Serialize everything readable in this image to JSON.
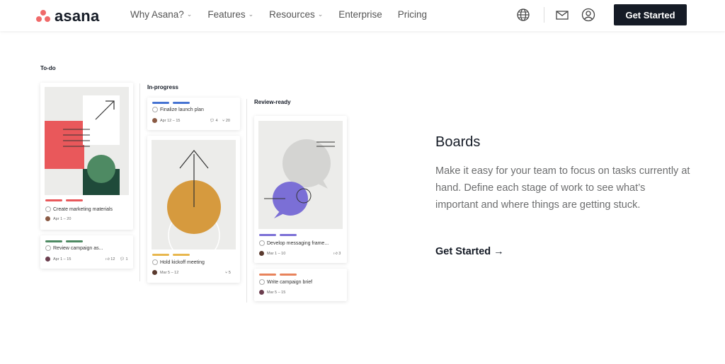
{
  "nav": {
    "logo_text": "asana",
    "menu": [
      {
        "label": "Why Asana?",
        "has_chevron": true
      },
      {
        "label": "Features",
        "has_chevron": true
      },
      {
        "label": "Resources",
        "has_chevron": true
      },
      {
        "label": "Enterprise",
        "has_chevron": false
      },
      {
        "label": "Pricing",
        "has_chevron": false
      }
    ],
    "cta_label": "Get Started",
    "icons": [
      "globe-icon",
      "mail-icon",
      "account-icon"
    ]
  },
  "board": {
    "columns": [
      {
        "title": "To-do"
      },
      {
        "title": "In-progress"
      },
      {
        "title": "Review-ready"
      }
    ],
    "cards": {
      "marketing": {
        "label": "Create marketing materials",
        "date": "Apr 1 – 20"
      },
      "campaign": {
        "label": "Review campaign as...",
        "date": "Apr 1 – 15",
        "likes": "12",
        "comments": "1"
      },
      "launch": {
        "label": "Finalize launch plan",
        "date": "Apr 12 – 15",
        "comments": "4",
        "subtasks": "20"
      },
      "kickoff": {
        "label": "Hold kickoff meeting",
        "date": "Mar 5 – 12",
        "subtasks": "5"
      },
      "messaging": {
        "label": "Develop messaging frame...",
        "date": "Mar 1 – 10",
        "likes": "3"
      },
      "brief": {
        "label": "Write campaign brief",
        "date": "Mar 5 – 15"
      }
    }
  },
  "feature": {
    "title": "Boards",
    "description": "Make it easy for your team to focus on tasks currently at hand. Define each stage of work to see what’s important and where things are getting stuck.",
    "link_label": "Get Started →"
  },
  "colors": {
    "brand": "#f06a6a",
    "dark": "#151b26",
    "text_muted": "#6d6e6f"
  }
}
